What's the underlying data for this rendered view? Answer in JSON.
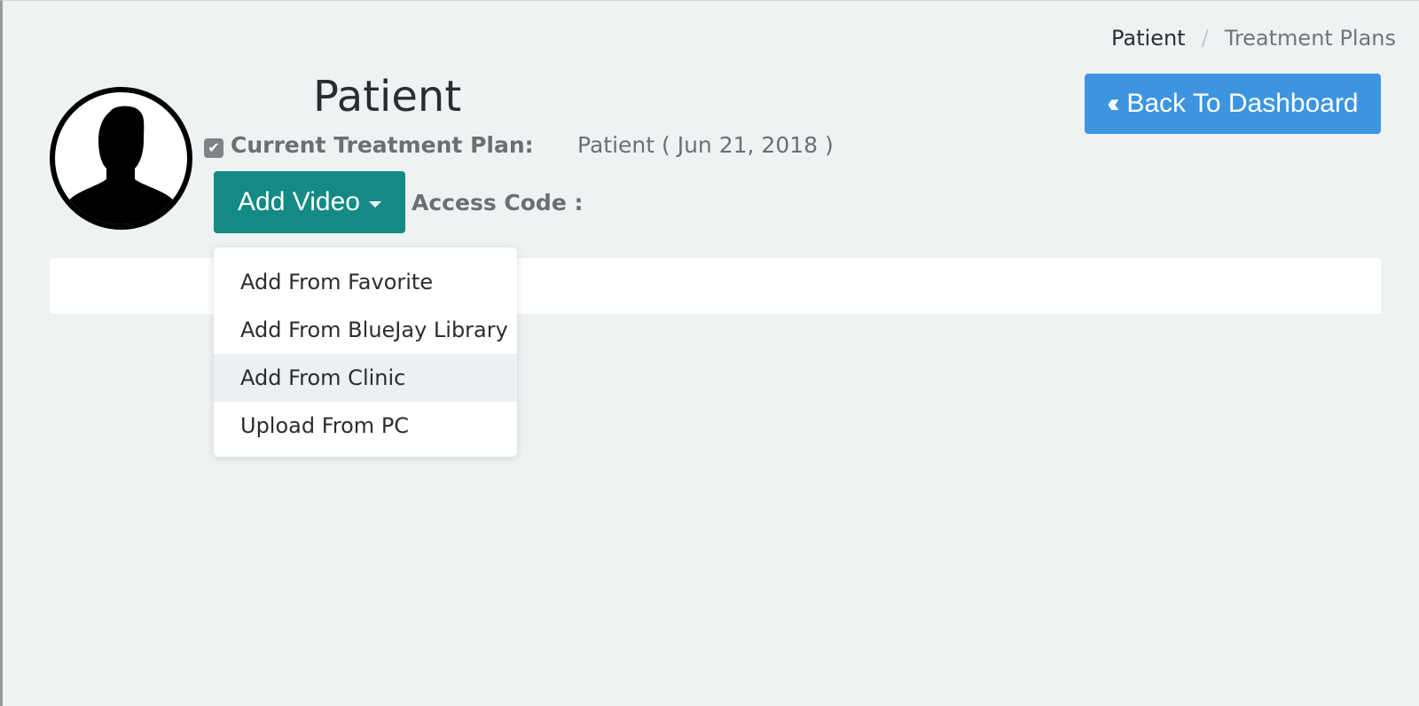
{
  "breadcrumb": {
    "items": [
      "Patient",
      "Treatment Plans"
    ],
    "separator": "/"
  },
  "header": {
    "back_button_icon": "double-chevron-left-icon",
    "back_button_label": "Back To Dashboard"
  },
  "patient": {
    "title": "Patient",
    "avatar_icon": "user-silhouette-icon",
    "current_plan_label": "Current Treatment Plan:",
    "current_plan_value": "Patient ( Jun 21, 2018 )",
    "current_plan_checked": true,
    "access_code_label": "Access Code :"
  },
  "add_video": {
    "label": "Add Video",
    "menu": [
      {
        "label": "Add From Favorite"
      },
      {
        "label": "Add From BlueJay Library"
      },
      {
        "label": "Add From Clinic"
      },
      {
        "label": "Upload From PC"
      }
    ],
    "highlighted_index": 2
  },
  "colors": {
    "background": "#eff2f3",
    "primary_blue": "#3d95e0",
    "teal": "#138a83"
  }
}
